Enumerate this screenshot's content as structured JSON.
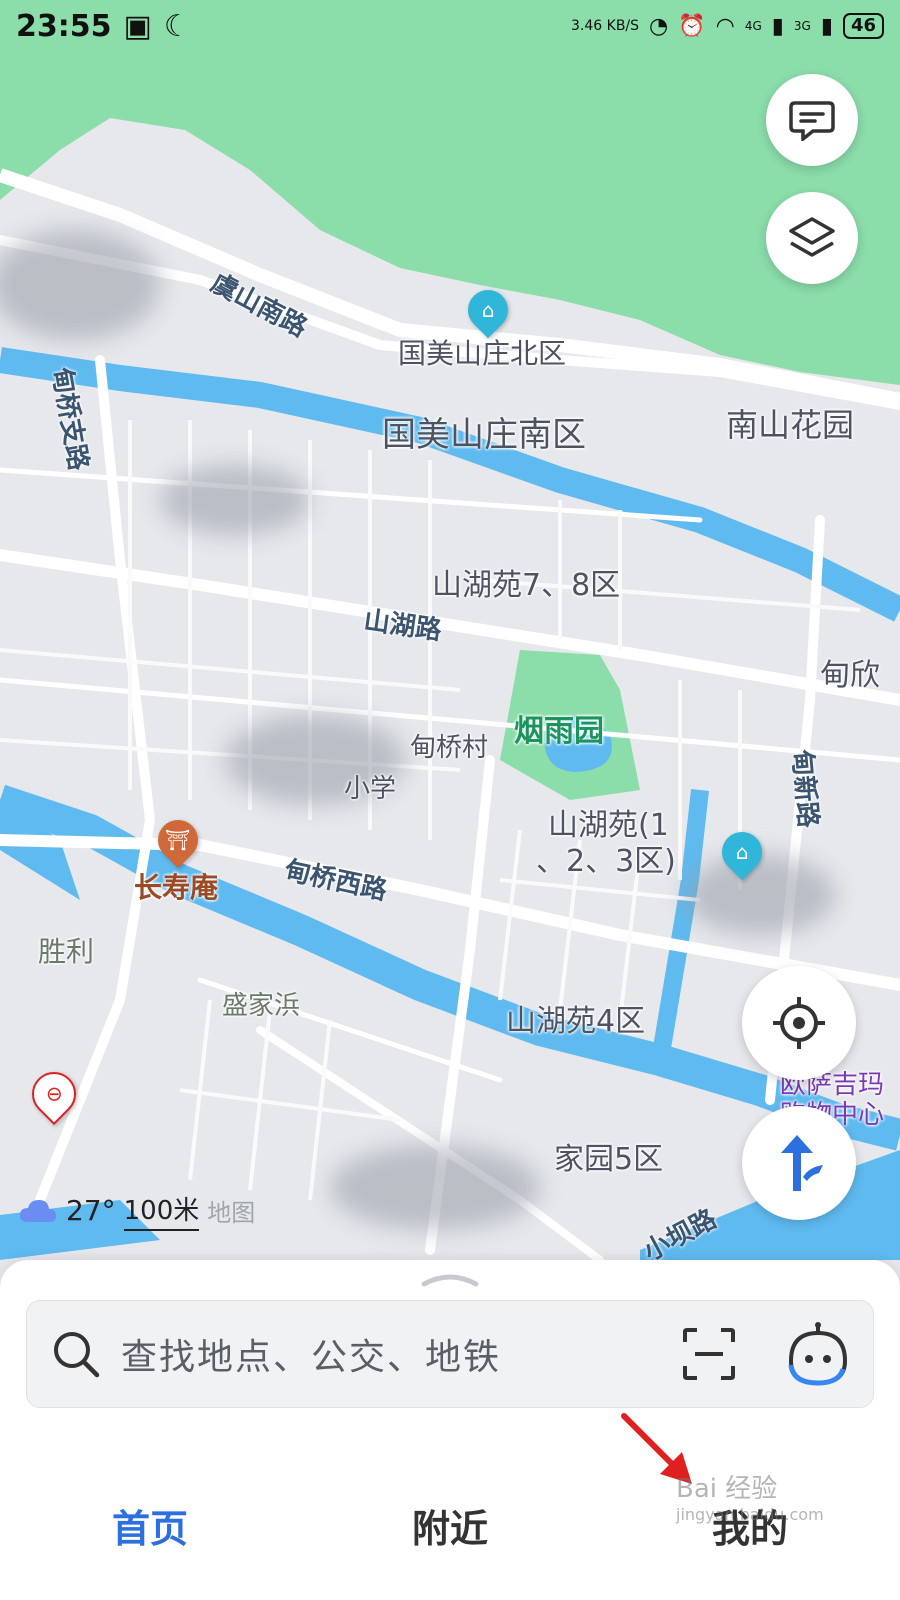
{
  "status_bar": {
    "time": "23:55",
    "speed": "3.46 KB/S",
    "network_1": "4G",
    "network_2": "3G",
    "battery": "46"
  },
  "map": {
    "labels": {
      "road_yushan_south": "虞山南路",
      "guomei_north": "国美山庄北区",
      "guomei_south": "国美山庄南区",
      "nanshan_garden": "南山花园",
      "road_dianqiao_branch": "甸桥支路",
      "shanhu_78": "山湖苑7、8区",
      "road_shanhu": "山湖路",
      "dianxin_partial": "甸欣",
      "yanyu_garden": "烟雨园",
      "dianqiao_village": "甸桥村",
      "school_partial": "小学",
      "shanhu_123_line1": "山湖苑(1",
      "shanhu_123_line2": "、2、3区)",
      "road_dianxin": "甸新路",
      "changshou_temple": "长寿庵",
      "road_dianqiao_west": "甸桥西路",
      "shengli": "胜利",
      "shengjiabang": "盛家浜",
      "shanhu_4": "山湖苑4区",
      "ousa_line1": "欧萨吉玛",
      "ousa_line2": "购物中心",
      "jiayuan_5": "家园5区",
      "road_xiaoba": "小坝路"
    },
    "weather_temp": "27°",
    "scale": "100米",
    "map_watermark": "地图"
  },
  "search": {
    "placeholder": "查找地点、公交、地铁"
  },
  "tabs": [
    {
      "label": "首页",
      "active": true
    },
    {
      "label": "附近",
      "active": false
    },
    {
      "label": "我的",
      "active": false
    }
  ],
  "watermark": {
    "brand": "Bai 经验",
    "url": "jingyan.baidu.com"
  },
  "colors": {
    "accent": "#2b6fe0",
    "park_green": "#8bddaa",
    "water_blue": "#5fbaf0",
    "annotation_red": "#e02020"
  }
}
